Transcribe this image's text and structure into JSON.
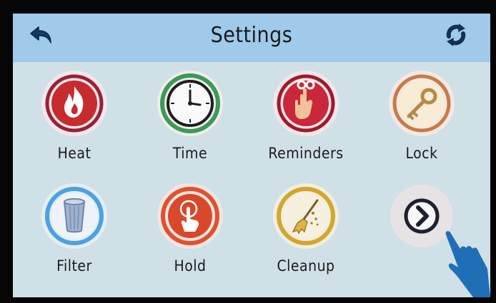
{
  "header": {
    "title": "Settings",
    "back_icon": "back-arrow-icon",
    "refresh_icon": "refresh-icon"
  },
  "tiles": [
    {
      "label": "Heat",
      "icon": "flame-icon",
      "ring_color": "#9a1f35"
    },
    {
      "label": "Time",
      "icon": "clock-icon",
      "ring_color": "#3a9a5a"
    },
    {
      "label": "Reminders",
      "icon": "reminder-hand-icon",
      "ring_color": "#a01a2a"
    },
    {
      "label": "Lock",
      "icon": "key-icon",
      "ring_color": "#c77a48"
    },
    {
      "label": "Filter",
      "icon": "filter-cartridge-icon",
      "ring_color": "#4aa3e0"
    },
    {
      "label": "Hold",
      "icon": "hold-touch-icon",
      "ring_color": "#e0512f"
    },
    {
      "label": "Cleanup",
      "icon": "broom-icon",
      "ring_color": "#d4a72c"
    }
  ],
  "next_button": {
    "icon": "chevron-right-icon"
  },
  "overlay": {
    "icon": "pointing-hand-icon",
    "color": "#1f6fb7"
  }
}
